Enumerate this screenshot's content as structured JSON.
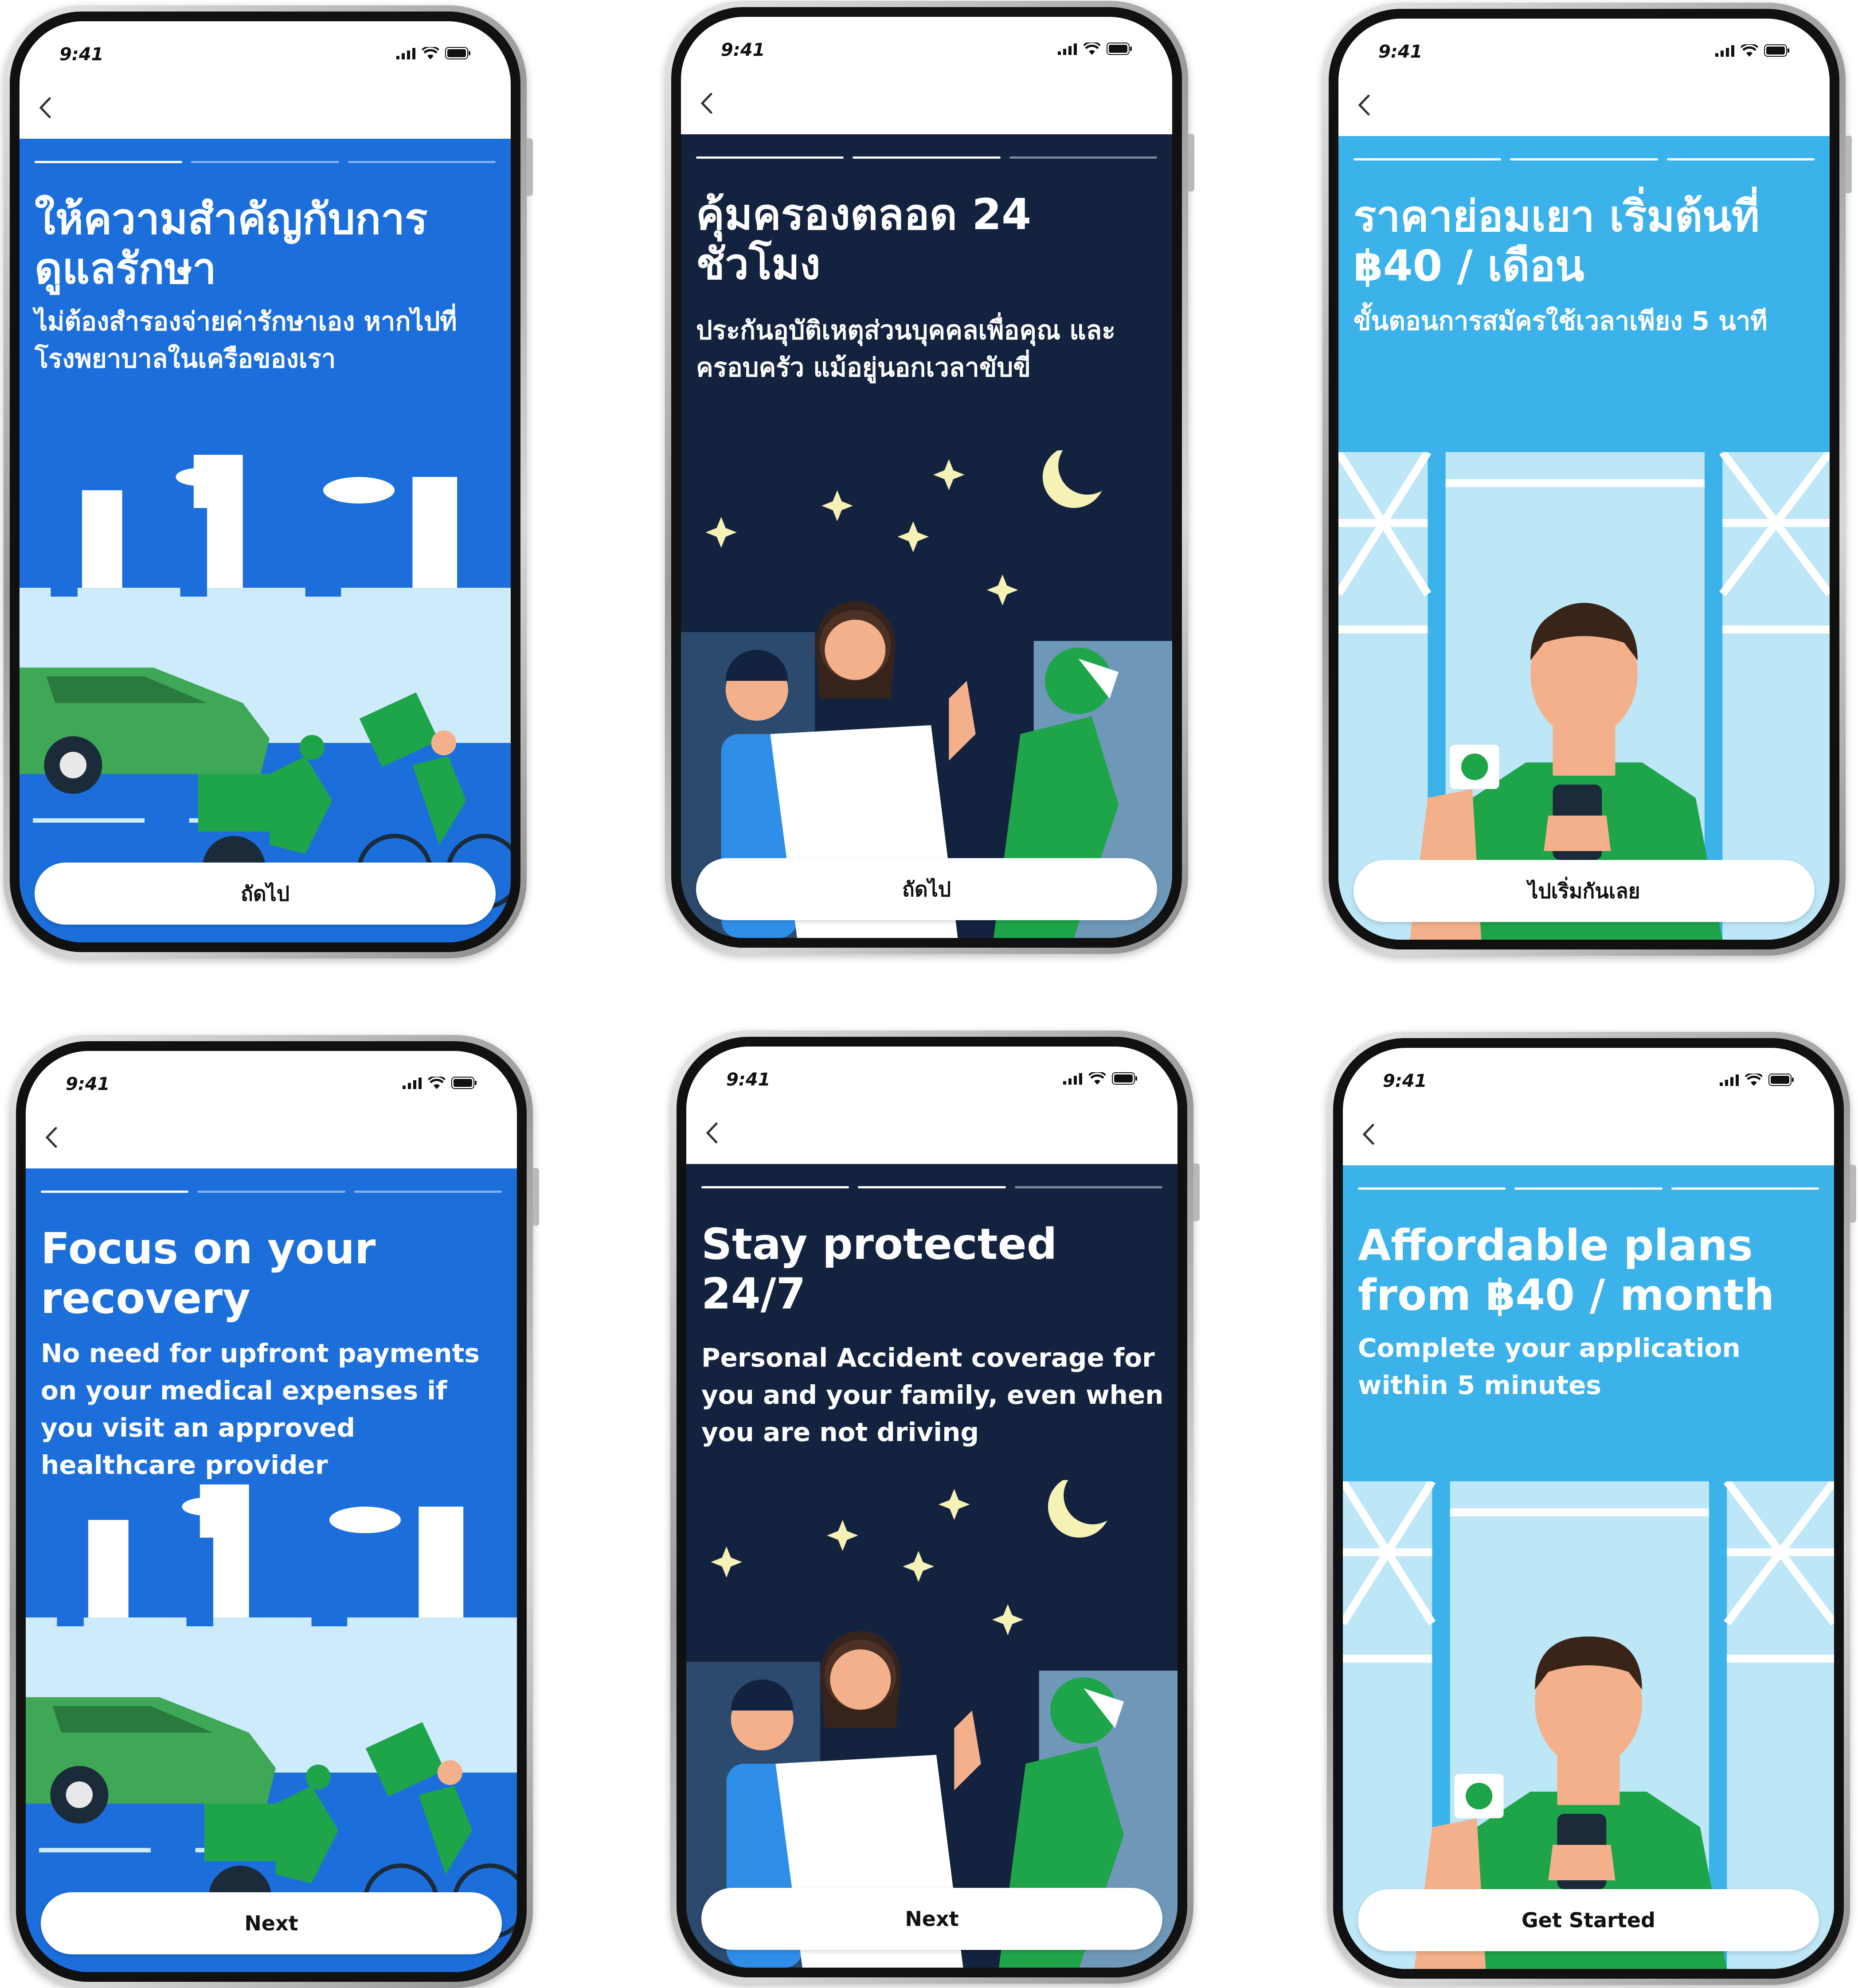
{
  "status": {
    "time": "9:41"
  },
  "colors": {
    "blue": "#1C6FDB",
    "navy": "#13233F",
    "sky": "#3CB2EA",
    "green": "#1EA54A"
  },
  "screens": [
    {
      "theme": "blue",
      "active_step": 1,
      "title": "ให้ความสำคัญกับการ ดูแลรักษา",
      "subtitle": "ไม่ต้องสำรองจ่ายค่ารักษาเอง หากไปที่ โรงพยาบาลในเครือของเรา",
      "button": "ถัดไป"
    },
    {
      "theme": "navy",
      "active_step": 2,
      "title": "คุ้มครองตลอด 24 ชั่วโมง",
      "subtitle": "ประกันอุบัติเหตุส่วนบุคคลเพื่อคุณ และครอบครัว แม้อยู่นอกเวลาขับขี่",
      "button": "ถัดไป"
    },
    {
      "theme": "sky",
      "active_step": 3,
      "title": "ราคาย่อมเยา เริ่มต้นที่ ฿40 / เดือน",
      "subtitle": "ขั้นตอนการสมัครใช้เวลาเพียง 5 นาที",
      "button": "ไปเริ่มกันเลย"
    },
    {
      "theme": "blue",
      "active_step": 1,
      "title": "Focus on your recovery",
      "subtitle": "No need for upfront payments on your medical expenses if you visit an approved healthcare provider",
      "button": "Next"
    },
    {
      "theme": "navy",
      "active_step": 2,
      "title": "Stay protected 24/7",
      "subtitle": "Personal Accident coverage for you and your family, even when you are not driving",
      "button": "Next"
    },
    {
      "theme": "sky",
      "active_step": 3,
      "title": "Affordable plans from ฿40 / month",
      "subtitle": "Complete your application within 5 minutes",
      "button": "Get Started"
    }
  ]
}
